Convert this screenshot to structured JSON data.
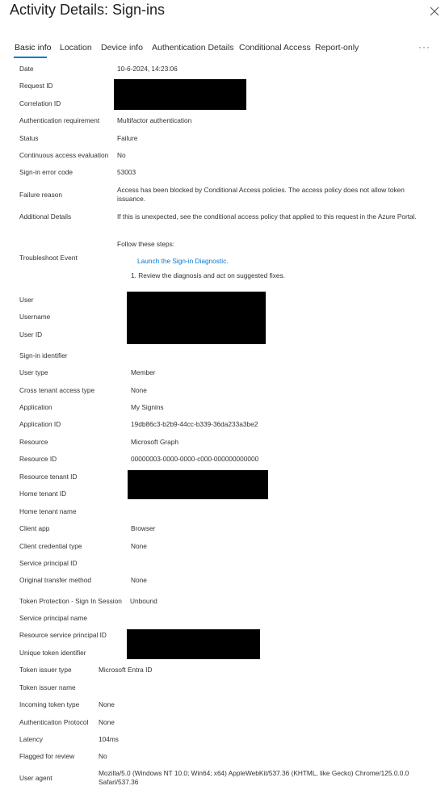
{
  "window": {
    "title": "Activity Details: Sign-ins"
  },
  "tabs": [
    {
      "label": "Basic info",
      "active": true
    },
    {
      "label": "Location"
    },
    {
      "label": "Device info"
    },
    {
      "label": "Authentication Details"
    },
    {
      "label": "Conditional Access"
    },
    {
      "label": "Report-only"
    }
  ],
  "more_label": "···",
  "icons": {
    "close": "close-icon",
    "more": "more-icon"
  },
  "colors": {
    "accent": "#0078d4",
    "redaction": "#000000"
  },
  "rows": {
    "date": {
      "label": "Date",
      "value": "10-6-2024, 14:23:06"
    },
    "request_id": {
      "label": "Request ID"
    },
    "correlation_id": {
      "label": "Correlation ID"
    },
    "auth_requirement": {
      "label": "Authentication requirement",
      "value": "Multifactor authentication"
    },
    "status": {
      "label": "Status",
      "value": "Failure"
    },
    "cae": {
      "label": "Continuous access evaluation",
      "value": "No"
    },
    "error_code": {
      "label": "Sign-in error code",
      "value": "53003"
    },
    "failure_reason": {
      "label": "Failure reason",
      "value": "Access has been blocked by Conditional Access policies. The access policy does not allow token issuance."
    },
    "additional_details": {
      "label": "Additional Details",
      "value": "If this is unexpected, see the conditional access policy that applied to this request in the Azure Portal."
    },
    "troubleshoot": {
      "label": "Troubleshoot Event",
      "intro": "Follow these steps:",
      "link": "Launch the Sign-in Diagnostic.",
      "step1": "1. Review the diagnosis and act on suggested fixes."
    },
    "user": {
      "label": "User"
    },
    "username": {
      "label": "Username"
    },
    "user_id": {
      "label": "User ID"
    },
    "signin_identifier": {
      "label": "Sign-in identifier"
    },
    "user_type": {
      "label": "User type",
      "value": "Member"
    },
    "cross_tenant": {
      "label": "Cross tenant access type",
      "value": "None"
    },
    "application": {
      "label": "Application",
      "value": "My Signins"
    },
    "application_id": {
      "label": "Application ID",
      "value": "19db86c3-b2b9-44cc-b339-36da233a3be2"
    },
    "resource": {
      "label": "Resource",
      "value": "Microsoft Graph"
    },
    "resource_id": {
      "label": "Resource ID",
      "value": "00000003-0000-0000-c000-000000000000"
    },
    "resource_tenant_id": {
      "label": "Resource tenant ID"
    },
    "home_tenant_id": {
      "label": "Home tenant ID"
    },
    "home_tenant_name": {
      "label": "Home tenant name"
    },
    "client_app": {
      "label": "Client app",
      "value": "Browser"
    },
    "client_credential_type": {
      "label": "Client credential type",
      "value": "None"
    },
    "service_principal_id": {
      "label": "Service principal ID"
    },
    "original_transfer_method": {
      "label": "Original transfer method",
      "value": "None"
    },
    "token_protection": {
      "label": "Token Protection - Sign In Session",
      "value": "Unbound"
    },
    "service_principal_name": {
      "label": "Service principal name"
    },
    "resource_sp_id": {
      "label": "Resource service principal ID"
    },
    "unique_token_id": {
      "label": "Unique token identifier"
    },
    "token_issuer_type": {
      "label": "Token issuer type",
      "value": "Microsoft Entra ID"
    },
    "token_issuer_name": {
      "label": "Token issuer name"
    },
    "incoming_token_type": {
      "label": "Incoming token type",
      "value": "None"
    },
    "auth_protocol": {
      "label": "Authentication Protocol",
      "value": "None"
    },
    "latency": {
      "label": "Latency",
      "value": "104ms"
    },
    "flagged": {
      "label": "Flagged for review",
      "value": "No"
    },
    "user_agent": {
      "label": "User agent",
      "value": "Mozilla/5.0 (Windows NT 10.0; Win64; x64) AppleWebKit/537.36 (KHTML, like Gecko) Chrome/125.0.0.0 Safari/537.36"
    }
  }
}
